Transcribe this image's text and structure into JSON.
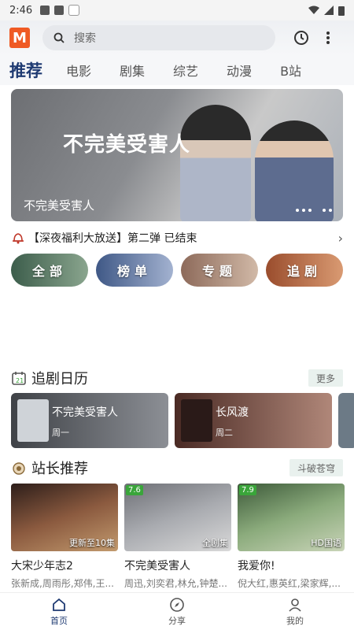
{
  "status_bar": {
    "time": "2:46"
  },
  "header": {
    "logo_letter": "M",
    "search_placeholder": "搜索"
  },
  "tabs": [
    {
      "label": "推荐",
      "active": true
    },
    {
      "label": "电影"
    },
    {
      "label": "剧集"
    },
    {
      "label": "综艺"
    },
    {
      "label": "动漫"
    },
    {
      "label": "B站"
    }
  ],
  "banner": {
    "art_title": "不完美受害人",
    "caption": "不完美受害人"
  },
  "notice": {
    "text": "【深夜福利大放送】第二弹 已结束"
  },
  "categories": [
    {
      "label": "全部",
      "color": "#4e6a5a"
    },
    {
      "label": "榜单",
      "color": "#5c6f95"
    },
    {
      "label": "专题",
      "color": "#a47f6d"
    },
    {
      "label": "追剧",
      "color": "#b56b48"
    }
  ],
  "calendar_section": {
    "title": "追剧日历",
    "more_label": "更多",
    "items": [
      {
        "name": "不完美受害人",
        "day": "周一",
        "color": "#5a5d63"
      },
      {
        "name": "长风渡",
        "day": "周二",
        "color": "#6f4d44"
      }
    ]
  },
  "recommend_section": {
    "title": "站长推荐",
    "action_label": "斗破苍穹",
    "items": [
      {
        "title": "大宋少年志2",
        "tag": "更新至10集",
        "score": "",
        "cast": "张新成,周雨彤,郑伟,王...",
        "color": "#6b3f33"
      },
      {
        "title": "不完美受害人",
        "tag": "全剧集",
        "score": "7.6",
        "cast": "周迅,刘奕君,林允,钟楚...",
        "color": "#7d7f86"
      },
      {
        "title": "我爱你!",
        "tag": "HD国语",
        "score": "7.9",
        "cast": "倪大红,惠英红,梁家辉,...",
        "color": "#6f8c66"
      }
    ]
  },
  "bottom_nav": [
    {
      "label": "首页",
      "active": true
    },
    {
      "label": "分享"
    },
    {
      "label": "我的"
    }
  ]
}
